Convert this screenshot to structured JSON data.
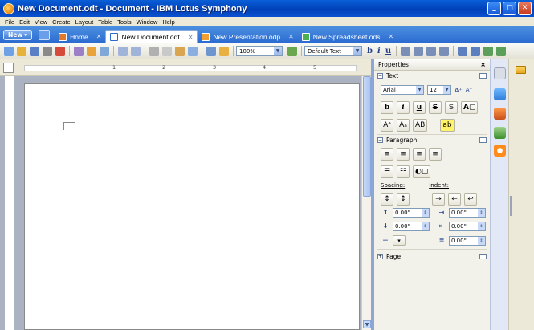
{
  "window": {
    "title": "New Document.odt - Document - IBM Lotus Symphony"
  },
  "menu": [
    "File",
    "Edit",
    "View",
    "Create",
    "Layout",
    "Table",
    "Tools",
    "Window",
    "Help"
  ],
  "tabs": {
    "new_label": "New",
    "items": [
      {
        "label": "Home",
        "active": false
      },
      {
        "label": "New Document.odt",
        "active": true
      },
      {
        "label": "New Presentation.odp",
        "active": false
      },
      {
        "label": "New Spreadsheet.ods",
        "active": false
      }
    ]
  },
  "toolbar": {
    "zoom": "100%",
    "style": "Default Text",
    "bold": "b",
    "italic": "i",
    "underline": "u"
  },
  "ruler": {
    "numbers": [
      "1",
      "2",
      "3",
      "4",
      "5"
    ]
  },
  "properties": {
    "title": "Properties",
    "close": "×",
    "text_section": "Text",
    "font": "Arial",
    "size": "12",
    "paragraph_section": "Paragraph",
    "spacing_label": "Spacing:",
    "indent_label": "Indent:",
    "values": [
      "0.00\"",
      "0.00\"",
      "0.00\"",
      "0.00\"",
      "0.00\""
    ],
    "page_section": "Page"
  }
}
